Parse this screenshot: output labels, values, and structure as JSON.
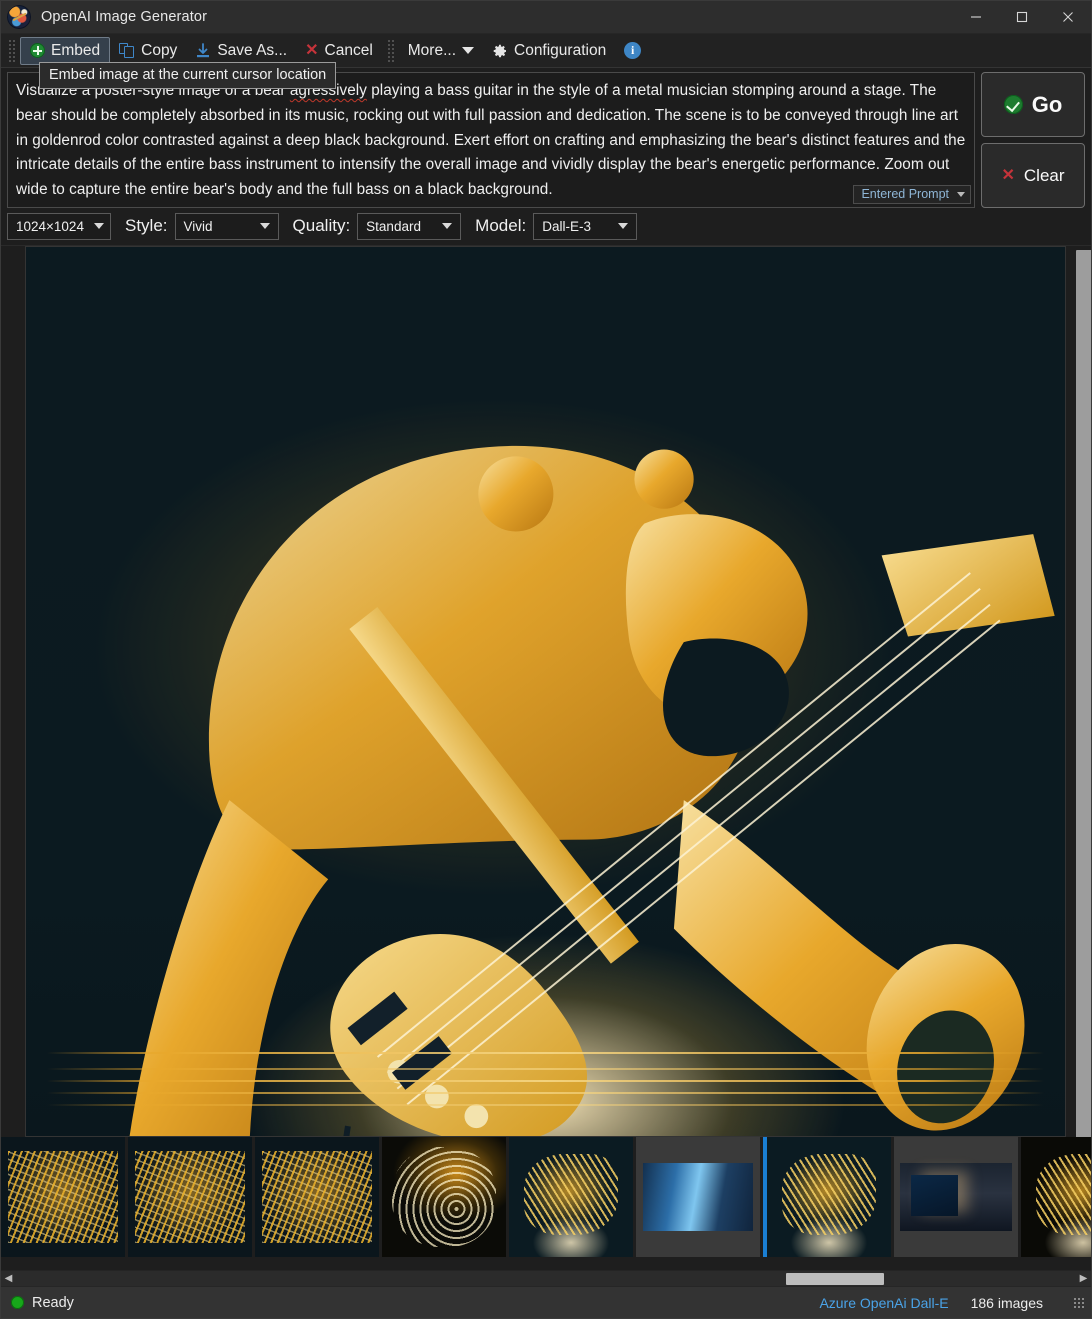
{
  "window": {
    "title": "OpenAI Image Generator",
    "app_icon": "app-logo-icon",
    "minimize": "minimize-icon",
    "maximize": "maximize-icon",
    "close": "close-icon"
  },
  "toolbar": {
    "embed_label": "Embed",
    "copy_label": "Copy",
    "save_as_label": "Save As...",
    "cancel_label": "Cancel",
    "more_label": "More...",
    "configuration_label": "Configuration",
    "info_label": "i",
    "tooltip": "Embed image at the current cursor location"
  },
  "prompt": {
    "text_part1": "Visualize a poster-style image of a bear ",
    "text_misspelled": "agressively",
    "text_part2": " playing a bass guitar in the style of a metal musician stomping around a stage. The bear should be completely absorbed in its music, rocking out with full passion and dedication. The scene is to be conveyed through line art in goldenrod color contrasted against a deep black background. Exert effort on crafting and emphasizing the bear's distinct features and the intricate details of the entire bass instrument to intensify the overall image and vividly display the bear's energetic performance. Zoom out wide to capture the entire bear's body and the full bass on a black background.",
    "source_chip": "Entered Prompt"
  },
  "actions": {
    "go_label": "Go",
    "clear_label": "Clear"
  },
  "options": {
    "size_value": "1024×1024",
    "style_label": "Style:",
    "style_value": "Vivid",
    "quality_label": "Quality:",
    "quality_value": "Standard",
    "model_label": "Model:",
    "model_value": "Dall-E-3"
  },
  "viewer": {
    "image_alt": "golden line-art bear playing a bass guitar on black background"
  },
  "thumbnails": [
    {
      "alt": "bear drum kit line art",
      "kind": "band",
      "selected": false
    },
    {
      "alt": "animal band on stage",
      "kind": "band",
      "selected": false
    },
    {
      "alt": "animal rock band performing",
      "kind": "band",
      "selected": false
    },
    {
      "alt": "bear surfing a golden wave",
      "kind": "wave",
      "selected": false
    },
    {
      "alt": "bear playing guitar line art",
      "kind": "bear",
      "selected": false
    },
    {
      "alt": "laptop photo with glowing screen",
      "kind": "laptop",
      "selected": false
    },
    {
      "alt": "golden bear playing bass guitar",
      "kind": "bear",
      "selected": true
    },
    {
      "alt": "person at desk with monitor photo",
      "kind": "desk",
      "selected": false
    },
    {
      "alt": "bear playing guitar on black",
      "kind": "bear-dark",
      "selected": false
    }
  ],
  "status": {
    "state": "Ready",
    "service": "Azure OpenAi Dall-E",
    "image_count": "186 images"
  }
}
